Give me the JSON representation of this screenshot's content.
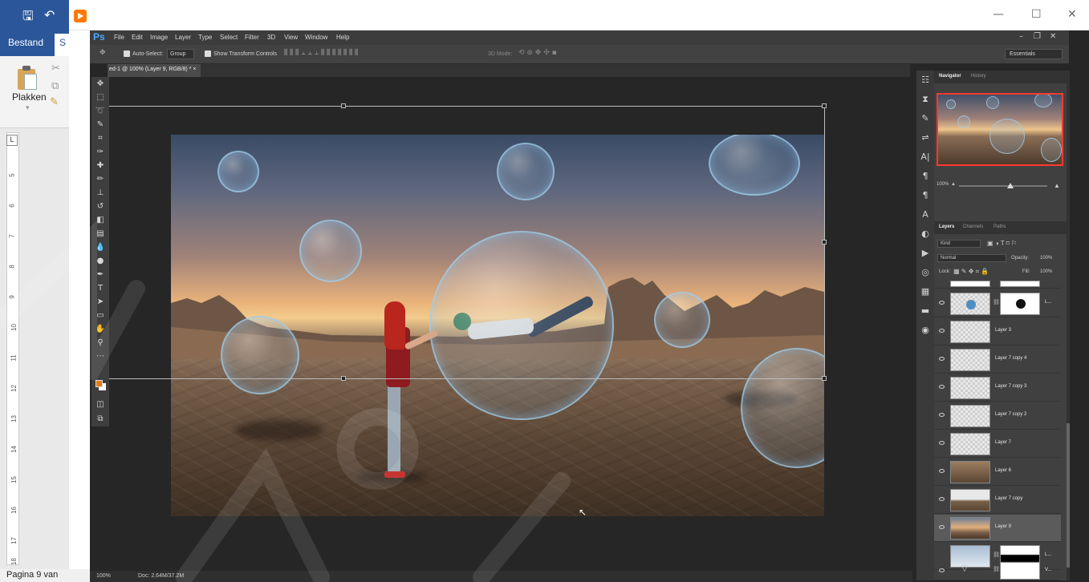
{
  "word": {
    "tabs": [
      "Bestand",
      "S"
    ],
    "paste_label": "Plakken",
    "status": "Pagina 9 van",
    "ruler_corner": "L",
    "ruler_numbers": [
      "5",
      "6",
      "7",
      "8",
      "9",
      "10",
      "11",
      "12",
      "13",
      "14",
      "15",
      "16",
      "17",
      "18"
    ],
    "undo_glyph": "↶",
    "save_glyph": "🖫"
  },
  "window": {
    "minimize": "—",
    "maximize": "☐",
    "close": "✕"
  },
  "photoshop": {
    "logo": "Ps",
    "menu": [
      "File",
      "Edit",
      "Image",
      "Layer",
      "Type",
      "Select",
      "Filter",
      "3D",
      "View",
      "Window",
      "Help"
    ],
    "options": {
      "auto_select": "Auto-Select:",
      "group": "Group",
      "show_transform": "Show Transform Controls",
      "mode_3d": "3D Mode:",
      "workspace": "Essentials"
    },
    "document_tab": "ed-1 @ 100% (Layer 9, RGB/8) *",
    "document_close": "×",
    "status_zoom": "100%",
    "status_doc": "Doc: 2.64M/37.2M",
    "navigator": {
      "tabs": [
        "Navigator",
        "History"
      ],
      "zoom": "100%"
    },
    "layers_panel": {
      "tabs": [
        "Layers",
        "Channels",
        "Paths"
      ],
      "filter": "Kind",
      "blend_mode": "Normal",
      "opacity_label": "Opacity:",
      "opacity": "100%",
      "lock_label": "Lock:",
      "fill_label": "Fill:",
      "fill": "100%",
      "layers": [
        {
          "name": "L...",
          "thumb": "bubble",
          "mask": "circle"
        },
        {
          "name": "Layer 3",
          "thumb": "checker"
        },
        {
          "name": "Layer 7 copy 4",
          "thumb": "checker"
        },
        {
          "name": "Layer 7 copy 3",
          "thumb": "checker"
        },
        {
          "name": "Layer 7 copy 2",
          "thumb": "checker"
        },
        {
          "name": "Layer 7",
          "thumb": "checker"
        },
        {
          "name": "Layer 6",
          "thumb": "sand"
        },
        {
          "name": "Layer 7 copy",
          "thumb": "rocks"
        },
        {
          "name": "Layer 9",
          "thumb": "photo",
          "selected": true
        },
        {
          "name": "L...",
          "thumb": "sky",
          "mask": "horizon"
        },
        {
          "name": "V...",
          "thumb": "white",
          "adjustment": true
        }
      ]
    },
    "accent_color": "#e07d17"
  }
}
